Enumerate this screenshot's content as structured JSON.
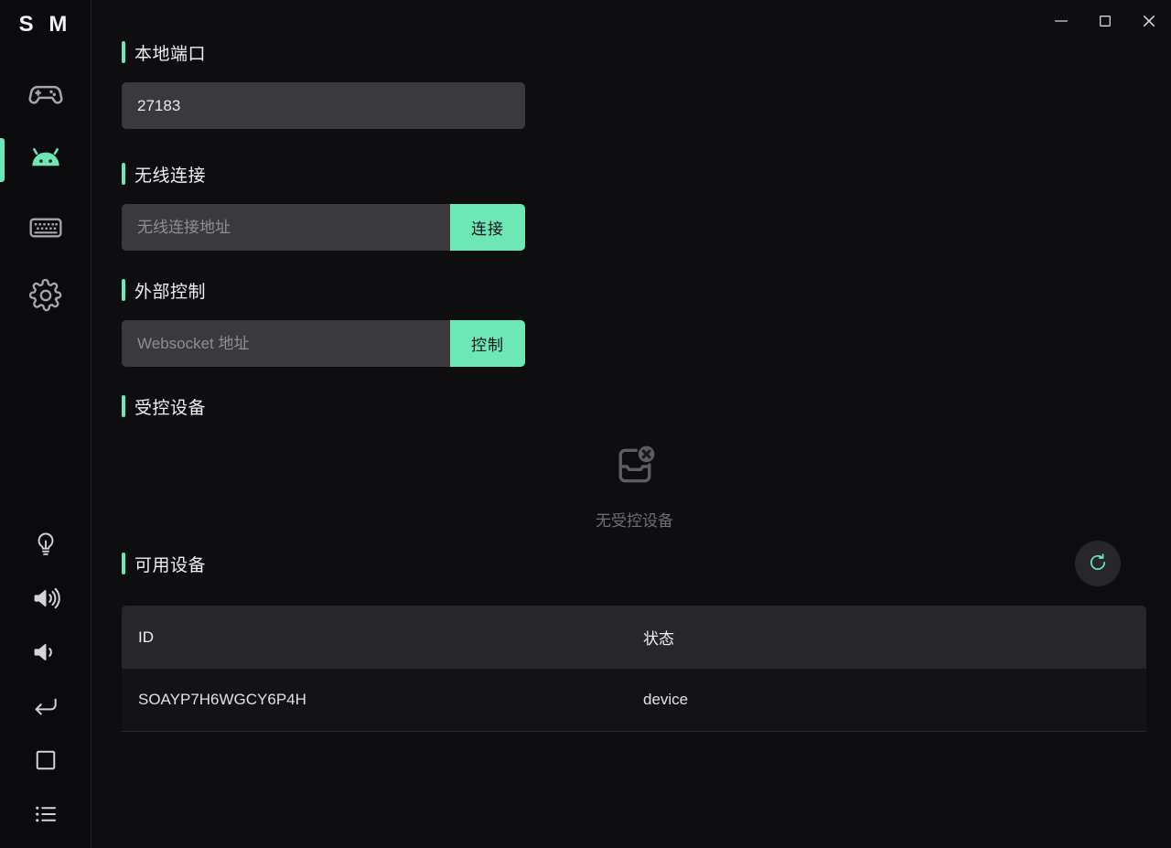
{
  "app": {
    "logo": "S M",
    "accent_color": "#6ee7b7",
    "background_color": "#0e0e11",
    "sidebar_color": "#0b0b0e"
  },
  "titlebar": {
    "minimize_label": "minimize",
    "maximize_label": "maximize",
    "close_label": "close"
  },
  "sidebar": {
    "top_items": [
      {
        "name": "gamepad",
        "icon": "gamepad-icon",
        "active": false
      },
      {
        "name": "android",
        "icon": "android-icon",
        "active": true
      },
      {
        "name": "keyboard",
        "icon": "keyboard-icon",
        "active": false
      },
      {
        "name": "settings",
        "icon": "gear-icon",
        "active": false
      }
    ],
    "bottom_items": [
      {
        "name": "power",
        "icon": "lightbulb-icon"
      },
      {
        "name": "volume-up",
        "icon": "volume-up-icon"
      },
      {
        "name": "volume-down",
        "icon": "volume-down-icon"
      },
      {
        "name": "back",
        "icon": "back-arrow-icon"
      },
      {
        "name": "home",
        "icon": "home-square-icon"
      },
      {
        "name": "recent-apps",
        "icon": "list-icon"
      }
    ]
  },
  "main": {
    "local_port": {
      "title": "本地端口",
      "value": "27183"
    },
    "wireless": {
      "title": "无线连接",
      "placeholder": "无线连接地址",
      "value": "",
      "button": "连接"
    },
    "external_control": {
      "title": "外部控制",
      "placeholder": "Websocket 地址",
      "value": "",
      "button": "控制"
    },
    "controlled_devices": {
      "title": "受控设备",
      "empty_text": "无受控设备",
      "empty_icon": "inbox-x-icon"
    },
    "available_devices": {
      "title": "可用设备",
      "refresh_icon": "refresh-icon",
      "columns": [
        "ID",
        "状态"
      ],
      "rows": [
        {
          "id": "SOAYP7H6WGCY6P4H",
          "status": "device"
        }
      ]
    }
  }
}
